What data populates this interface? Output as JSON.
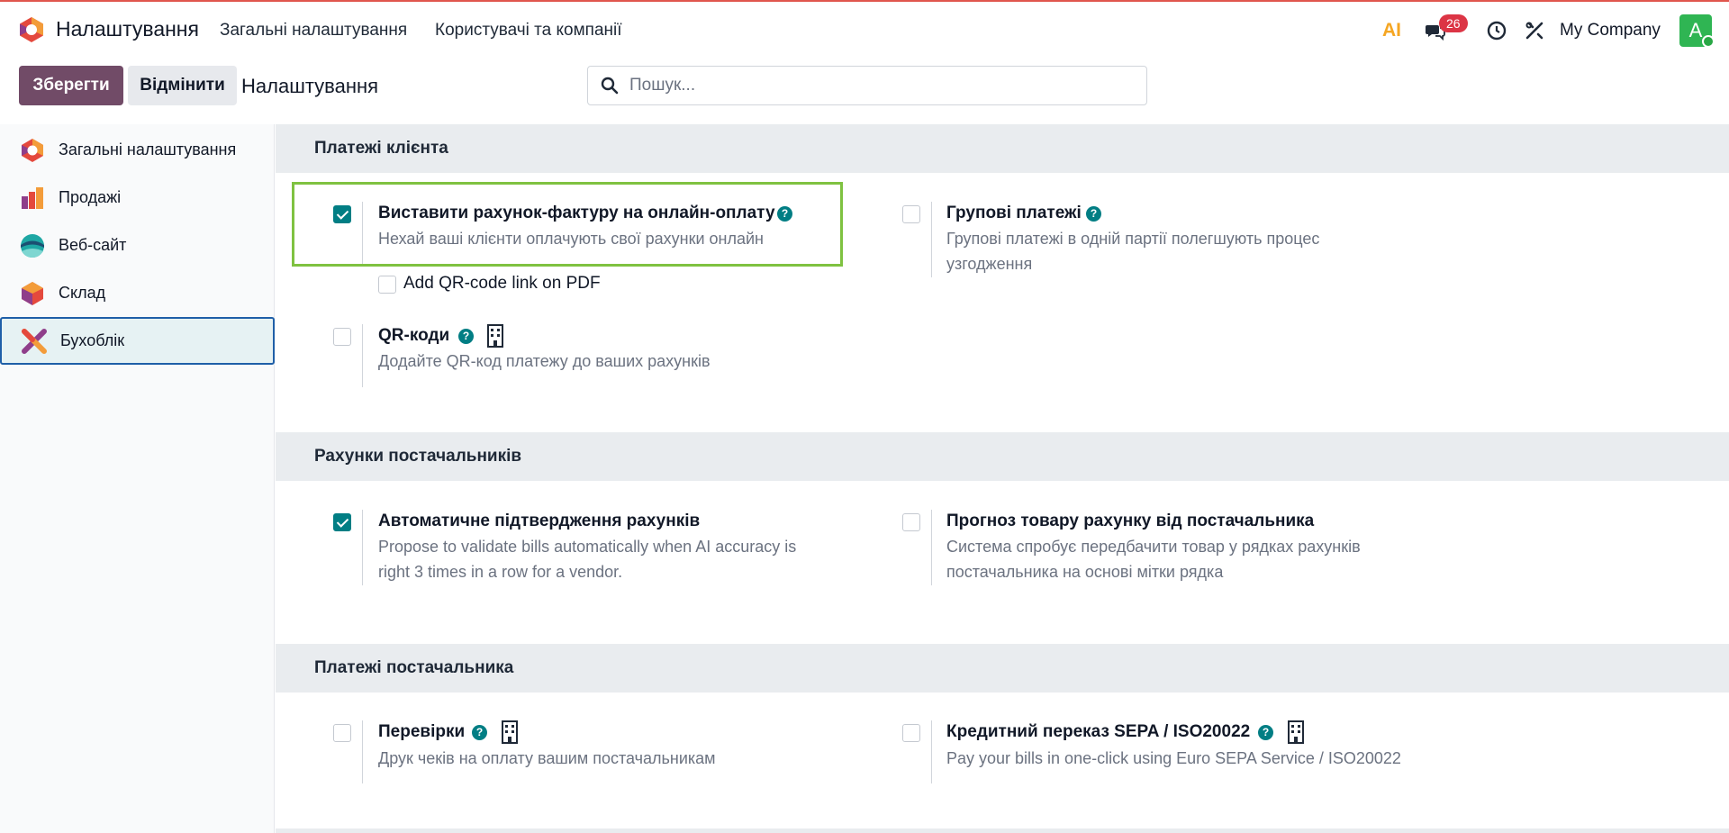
{
  "navbar": {
    "app_title": "Налаштування",
    "menu": [
      "Загальні налаштування",
      "Користувачі та компанії"
    ],
    "ai_label": "AI",
    "messages_badge": "26",
    "company": "My Company",
    "avatar_letter": "A"
  },
  "control_panel": {
    "save_label": "Зберегти",
    "discard_label": "Відмінити",
    "breadcrumb": "Налаштування",
    "search_placeholder": "Пошук..."
  },
  "sidebar": {
    "items": [
      {
        "label": "Загальні налаштування",
        "icon": "odoo-logo-icon"
      },
      {
        "label": "Продажі",
        "icon": "sales-icon"
      },
      {
        "label": "Веб-сайт",
        "icon": "website-icon"
      },
      {
        "label": "Склад",
        "icon": "inventory-icon"
      },
      {
        "label": "Бухоблік",
        "icon": "accounting-icon",
        "active": true
      }
    ]
  },
  "sections": {
    "customer_payments": {
      "title": "Платежі клієнта",
      "invoice_online": {
        "title": "Виставити рахунок-фактуру на онлайн-оплату",
        "desc": "Нехай ваші клієнти оплачують свої рахунки онлайн",
        "checked": true
      },
      "qr_link": {
        "label": "Add QR-code link on PDF",
        "checked": false
      },
      "qr_codes": {
        "title": "QR-коди",
        "desc": "Додайте QR-код платежу до ваших рахунків",
        "checked": false
      },
      "batch_payments": {
        "title": "Групові платежі",
        "desc_line1": "Групові платежі в одній партії полегшують процес",
        "desc_line2": "узгодження",
        "checked": false
      }
    },
    "vendor_bills": {
      "title": "Рахунки постачальників",
      "auto_validation": {
        "title": "Автоматичне підтвердження рахунків",
        "desc_line1": "Propose to validate bills automatically when AI accuracy is",
        "desc_line2": "right 3 times in a row for a vendor.",
        "checked": true
      },
      "product_prediction": {
        "title": "Прогноз товару рахунку від постачальника",
        "desc_line1": "Система спробує передбачити товар у рядках рахунків",
        "desc_line2": "постачальника на основі мітки рядка",
        "checked": false
      }
    },
    "vendor_payments": {
      "title": "Платежі постачальника",
      "checks": {
        "title": "Перевірки",
        "desc": "Друк чеків на оплату вашим постачальникам",
        "checked": false
      },
      "sepa": {
        "title": "Кредитний переказ SEPA / ISO20022",
        "desc": "Pay your bills in one-click using Euro SEPA Service / ISO20022",
        "checked": false
      }
    }
  },
  "colors": {
    "primary": "#714b67",
    "accent": "#017e84",
    "highlight_border": "#7fc241",
    "badge": "#dc3545"
  }
}
